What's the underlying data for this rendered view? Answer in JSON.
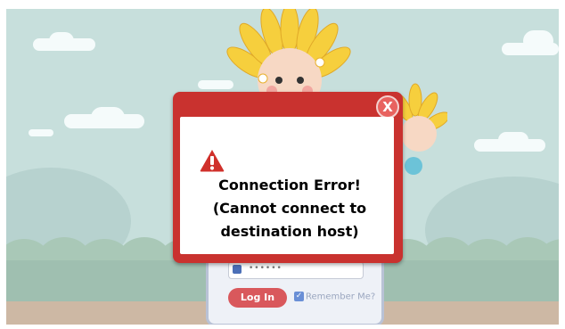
{
  "colors": {
    "sky": "#c7dfdc",
    "dialog_red": "#c9322f",
    "warning_red": "#d0302b",
    "login_button": "#d9585c"
  },
  "dialog": {
    "close_label": "X",
    "icon": "warning-triangle-icon",
    "message_lines": [
      "Connection Error!",
      "(Cannot connect to",
      "destination host)"
    ]
  },
  "login": {
    "password_value": "••••••",
    "login_label": "Log In",
    "remember_label": "Remember Me?"
  }
}
